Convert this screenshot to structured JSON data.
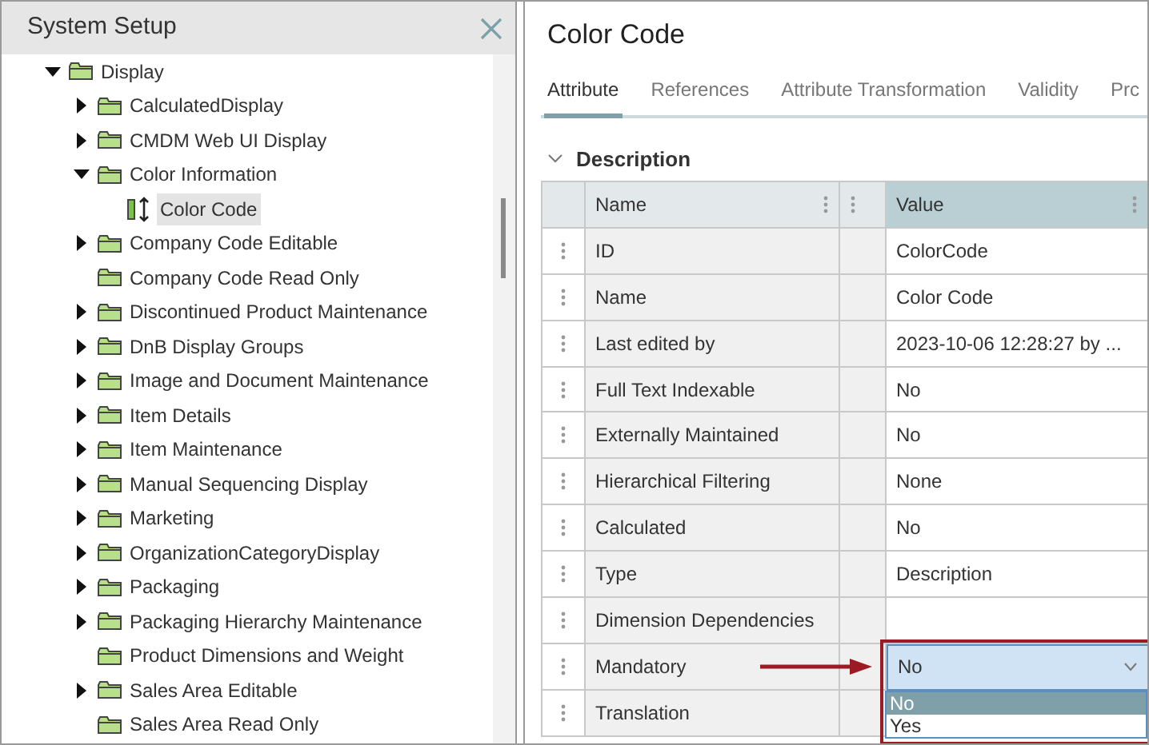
{
  "panel": {
    "title": "System Setup"
  },
  "tree": [
    {
      "label": "Display",
      "kind": "folder",
      "expanded": true,
      "selected": false,
      "children": [
        {
          "label": "CalculatedDisplay",
          "kind": "folder",
          "expanded": false,
          "selected": false
        },
        {
          "label": "CMDM Web UI Display",
          "kind": "folder",
          "expanded": false,
          "selected": false
        },
        {
          "label": "Color Information",
          "kind": "folder",
          "expanded": true,
          "selected": false,
          "children": [
            {
              "label": "Color Code",
              "kind": "attribute",
              "selected": true
            }
          ]
        },
        {
          "label": "Company Code Editable",
          "kind": "folder",
          "expanded": false,
          "selected": false
        },
        {
          "label": "Company Code Read Only",
          "kind": "folder",
          "selected": false
        },
        {
          "label": "Discontinued Product Maintenance",
          "kind": "folder",
          "expanded": false,
          "selected": false
        },
        {
          "label": "DnB Display Groups",
          "kind": "folder",
          "expanded": false,
          "selected": false
        },
        {
          "label": "Image and Document Maintenance",
          "kind": "folder",
          "expanded": false,
          "selected": false
        },
        {
          "label": "Item Details",
          "kind": "folder",
          "expanded": false,
          "selected": false
        },
        {
          "label": "Item Maintenance",
          "kind": "folder",
          "expanded": false,
          "selected": false
        },
        {
          "label": "Manual Sequencing Display",
          "kind": "folder",
          "expanded": false,
          "selected": false
        },
        {
          "label": "Marketing",
          "kind": "folder",
          "expanded": false,
          "selected": false
        },
        {
          "label": "OrganizationCategoryDisplay",
          "kind": "folder",
          "expanded": false,
          "selected": false
        },
        {
          "label": "Packaging",
          "kind": "folder",
          "expanded": false,
          "selected": false
        },
        {
          "label": "Packaging Hierarchy Maintenance",
          "kind": "folder",
          "expanded": false,
          "selected": false
        },
        {
          "label": "Product Dimensions and Weight",
          "kind": "folder",
          "selected": false
        },
        {
          "label": "Sales Area Editable",
          "kind": "folder",
          "expanded": false,
          "selected": false
        },
        {
          "label": "Sales Area Read Only",
          "kind": "folder",
          "selected": false
        }
      ]
    }
  ],
  "detail": {
    "title": "Color Code",
    "tabs": [
      {
        "label": "Attribute",
        "selected": true
      },
      {
        "label": "References",
        "selected": false
      },
      {
        "label": "Attribute Transformation",
        "selected": false
      },
      {
        "label": "Validity",
        "selected": false
      },
      {
        "label": "Prc",
        "selected": false
      }
    ],
    "section": {
      "title": "Description",
      "expanded": true
    },
    "columns": [
      "Name",
      "Value"
    ],
    "rows": [
      {
        "kind": "text",
        "name": "ID",
        "value": "ColorCode"
      },
      {
        "kind": "text",
        "name": "Name",
        "value": "Color Code"
      },
      {
        "kind": "text",
        "name": "Last edited by",
        "value": "2023-10-06 12:28:27 by ..."
      },
      {
        "kind": "text",
        "name": "Full Text Indexable",
        "value": "No"
      },
      {
        "kind": "text",
        "name": "Externally Maintained",
        "value": "No"
      },
      {
        "kind": "text",
        "name": "Hierarchical Filtering",
        "value": "None"
      },
      {
        "kind": "text",
        "name": "Calculated",
        "value": "No"
      },
      {
        "kind": "text",
        "name": "Type",
        "value": "Description"
      },
      {
        "kind": "text",
        "name": "Dimension Dependencies"
      },
      {
        "kind": "dropdown",
        "name": "Mandatory",
        "value": "No",
        "expanded": true,
        "options": [
          {
            "label": "No",
            "selected": true
          },
          {
            "label": "Yes",
            "selected": false
          }
        ]
      },
      {
        "kind": "text",
        "name": "Translation"
      }
    ]
  }
}
